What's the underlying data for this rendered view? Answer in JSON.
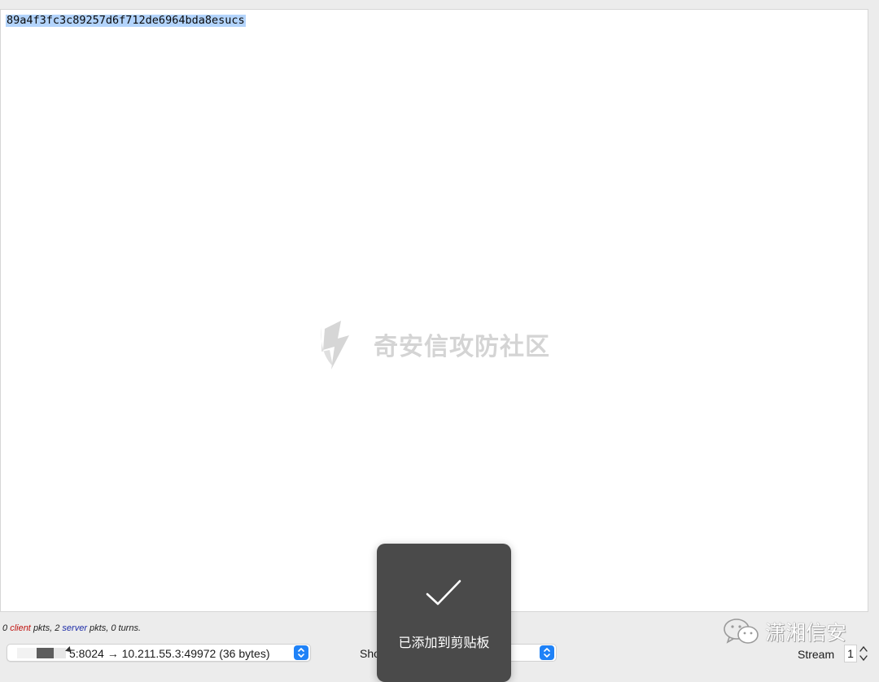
{
  "stream": {
    "content": "89a4f3fc3c89257d6f712de6964bda8esucs",
    "watermark": "奇安信攻防社区"
  },
  "summary": {
    "client_count": "0",
    "client_word": "client",
    "pkts_sep": "pkts,",
    "server_count": "2",
    "server_word": "server",
    "tail": "pkts, 0 turns."
  },
  "conversation": {
    "selected": "5:8024 → 10.211.55.3:49972 (36 bytes)"
  },
  "show": {
    "label": "Sho"
  },
  "toast": {
    "message": "已添加到剪贴板"
  },
  "branding": {
    "wechat_account": "潇湘信安"
  },
  "stream_selector": {
    "label": "Stream",
    "value": "1"
  },
  "colors": {
    "client": "#c0130f",
    "server": "#1d2ca8",
    "selection": "#b3d4fc",
    "stepper": "#1f82f7"
  }
}
